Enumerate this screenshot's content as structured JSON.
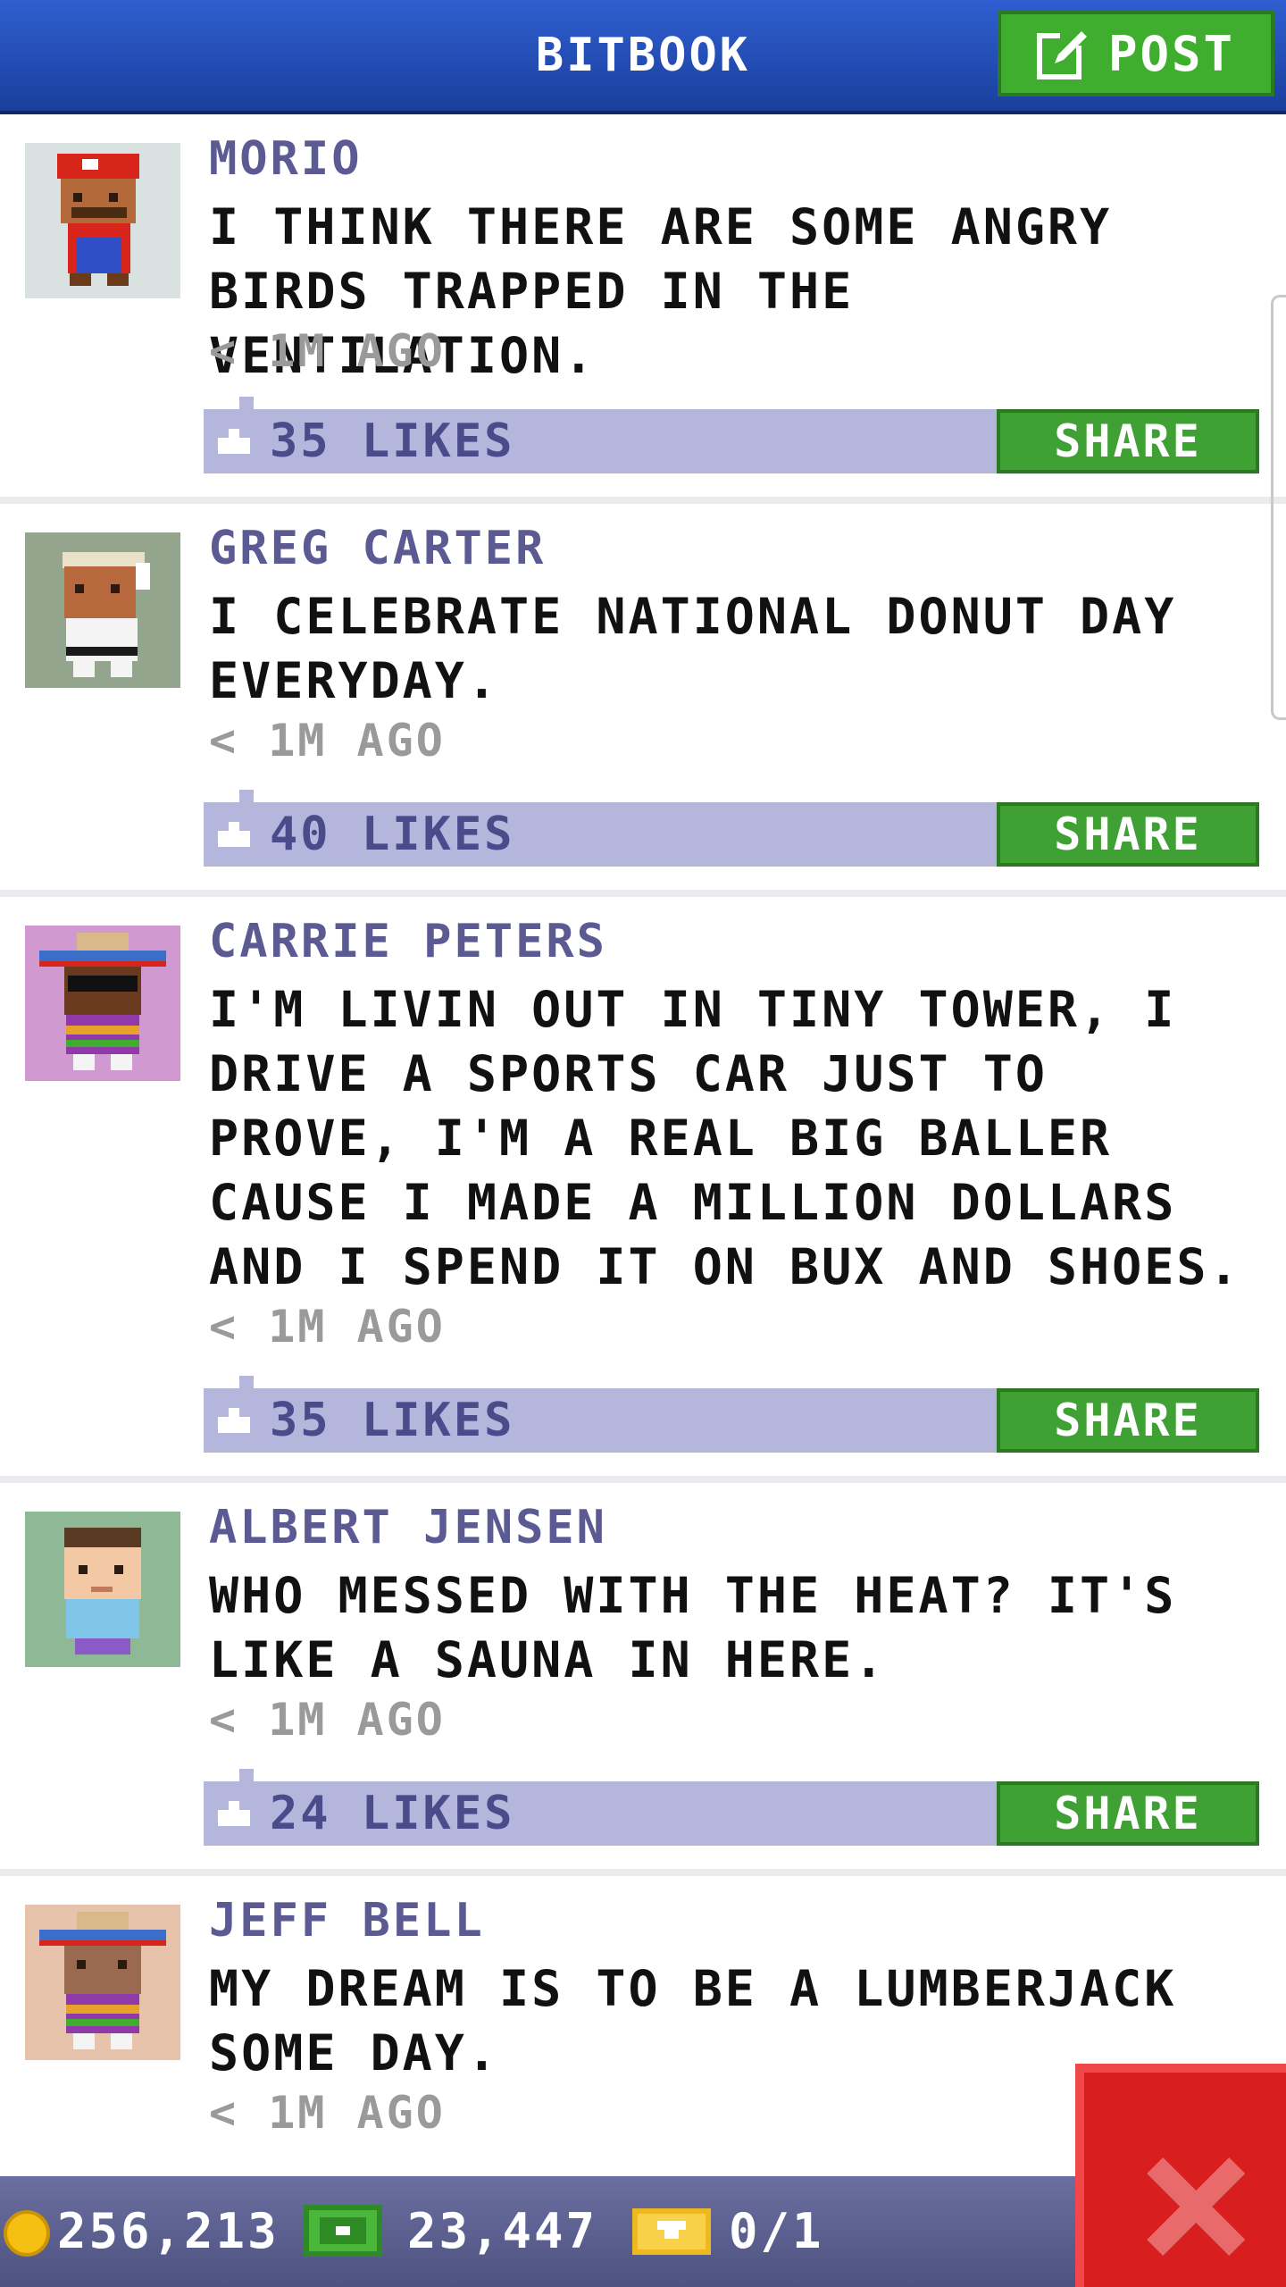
{
  "header": {
    "title": "BITBOOK",
    "post_label": "POST"
  },
  "posts": [
    {
      "name": "MORIO",
      "text": "I THINK THERE ARE SOME ANGRY BIRDS TRAPPED IN THE VENTILATION.",
      "time": "< 1M AGO",
      "likes": "35 LIKES",
      "share": "SHARE",
      "avatar_bg": "#d9e2e0"
    },
    {
      "name": "GREG CARTER",
      "text": "I CELEBRATE NATIONAL DONUT DAY EVERYDAY.",
      "time": "< 1M AGO",
      "likes": "40 LIKES",
      "share": "SHARE",
      "avatar_bg": "#93a58c"
    },
    {
      "name": "CARRIE PETERS",
      "text": "I'M LIVIN OUT IN TINY TOWER, I DRIVE A SPORTS CAR JUST TO PROVE, I'M A REAL BIG BALLER CAUSE I MADE A MILLION DOLLARS AND I SPEND IT ON BUX AND SHOES.",
      "time": "< 1M AGO",
      "likes": "35 LIKES",
      "share": "SHARE",
      "avatar_bg": "#d09ad0"
    },
    {
      "name": "ALBERT JENSEN",
      "text": "WHO MESSED WITH THE HEAT? IT'S LIKE A SAUNA IN HERE.",
      "time": "< 1M AGO",
      "likes": "24 LIKES",
      "share": "SHARE",
      "avatar_bg": "#8fb896"
    },
    {
      "name": "JEFF BELL",
      "text": "MY DREAM IS TO BE A LUMBERJACK SOME DAY.",
      "time": "< 1M AGO",
      "avatar_bg": "#e6c3aa"
    }
  ],
  "footer": {
    "coins": "256,213",
    "bux": "23,447",
    "tickets": "0/1"
  },
  "colors": {
    "header_blue": "#2f5fd0",
    "share_green": "#3fa033",
    "likes_bar": "#b4b6dc",
    "close_red": "#d81e1e"
  }
}
